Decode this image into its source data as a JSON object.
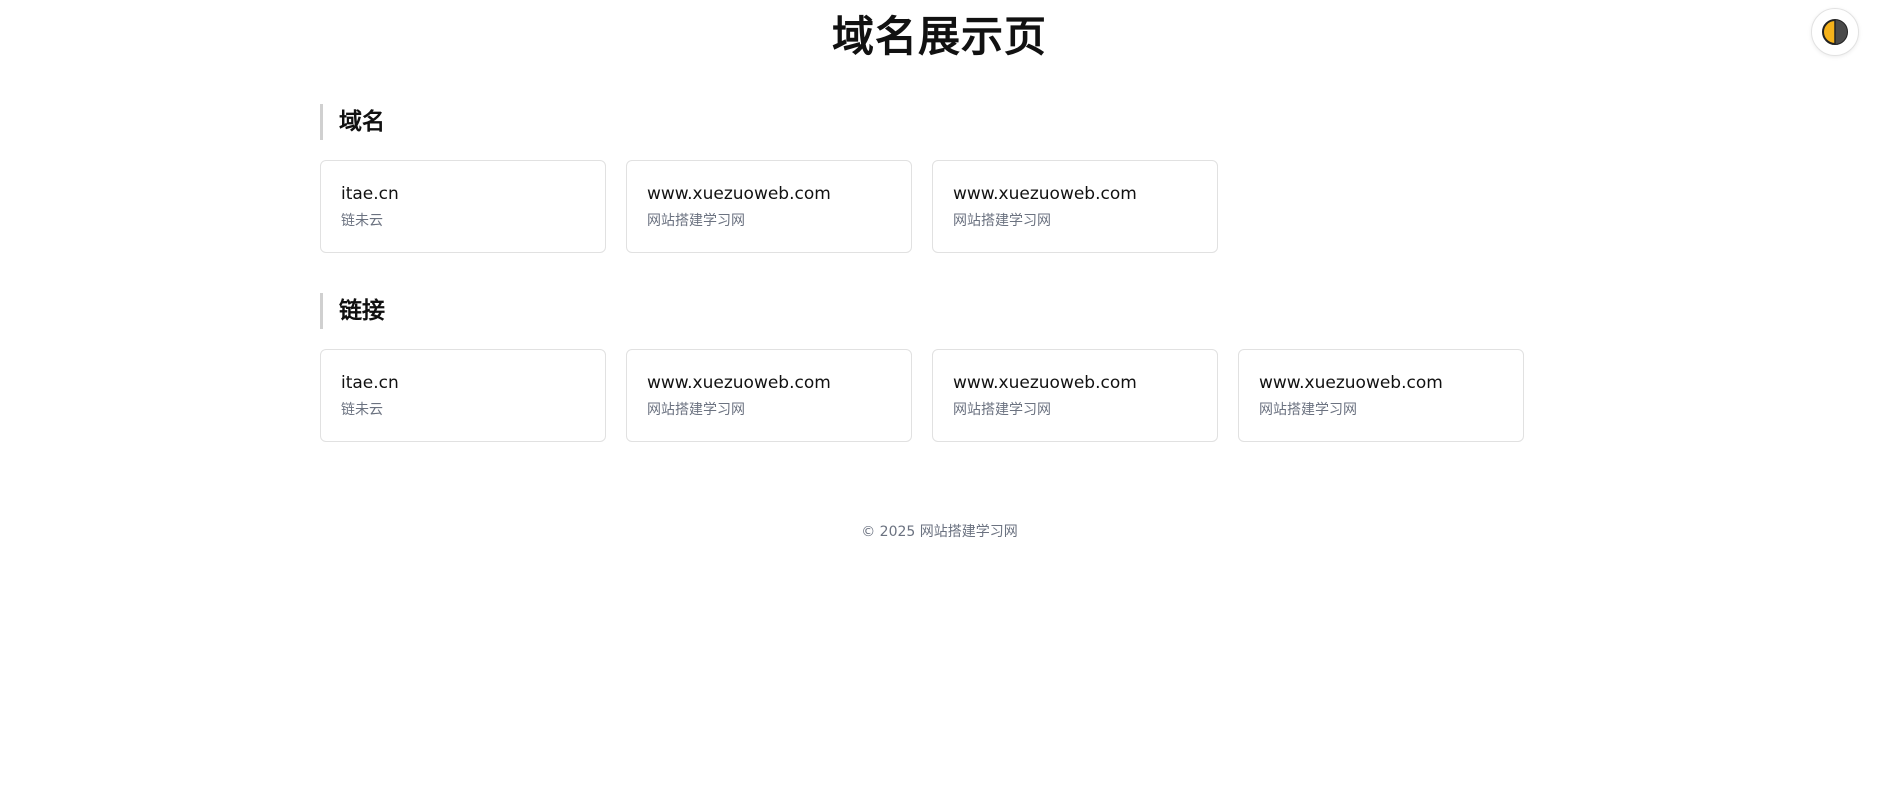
{
  "header": {
    "title": "域名展示页"
  },
  "sections": [
    {
      "title": "域名",
      "cards": [
        {
          "domain": "itae.cn",
          "desc": "链未云"
        },
        {
          "domain": "www.xuezuoweb.com",
          "desc": "网站搭建学习网"
        },
        {
          "domain": "www.xuezuoweb.com",
          "desc": "网站搭建学习网"
        }
      ]
    },
    {
      "title": "链接",
      "cards": [
        {
          "domain": "itae.cn",
          "desc": "链未云"
        },
        {
          "domain": "www.xuezuoweb.com",
          "desc": "网站搭建学习网"
        },
        {
          "domain": "www.xuezuoweb.com",
          "desc": "网站搭建学习网"
        },
        {
          "domain": "www.xuezuoweb.com",
          "desc": "网站搭建学习网"
        }
      ]
    }
  ],
  "footer": {
    "text": "© 2025 网站搭建学习网"
  },
  "icons": {
    "theme_toggle": "half-moon-contrast-icon"
  },
  "colors": {
    "accent_yellow": "#f5b21b",
    "accent_dark": "#4a4a4a"
  }
}
